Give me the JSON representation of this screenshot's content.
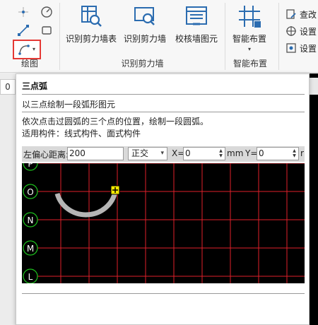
{
  "ribbon": {
    "draw_group": {
      "label": "绘图"
    },
    "shear_wall_group": {
      "label": "识别剪力墙",
      "buttons": [
        {
          "label": "识别剪力墙表"
        },
        {
          "label": "识别剪力墙"
        },
        {
          "label": "校核墙图元"
        }
      ]
    },
    "smart_group": {
      "label": "智能布置",
      "button": {
        "label": "智能布置"
      }
    },
    "right_items": [
      {
        "label": "查改"
      },
      {
        "label": "设置"
      },
      {
        "label": "设置"
      }
    ]
  },
  "left_strip": {
    "value": "0"
  },
  "tooltip": {
    "title": "三点弧",
    "subtitle": "以三点绘制一段弧形图元",
    "description": "依次点击过圆弧的三个点的位置，绘制一段圆弧。",
    "applicable": "适用构件：线式构件、面式构件",
    "toolbar": {
      "offset_label": "左偏心距离:",
      "offset_value": "200",
      "mode_value": "正交",
      "x_label": "X=",
      "x_value": "0",
      "x_unit": "mm",
      "y_label": "Y=",
      "y_value": "0",
      "y_unit_partial": "r"
    },
    "axis_labels": [
      "P",
      "O",
      "N",
      "M",
      "L"
    ]
  },
  "colors": {
    "highlight_border": "#e53935",
    "grid": "#e0202a",
    "axis_circle": "#1ec41e",
    "arc": "#b5b5b5",
    "cursor": "#f5e800",
    "icon_blue": "#2b6cb0"
  }
}
